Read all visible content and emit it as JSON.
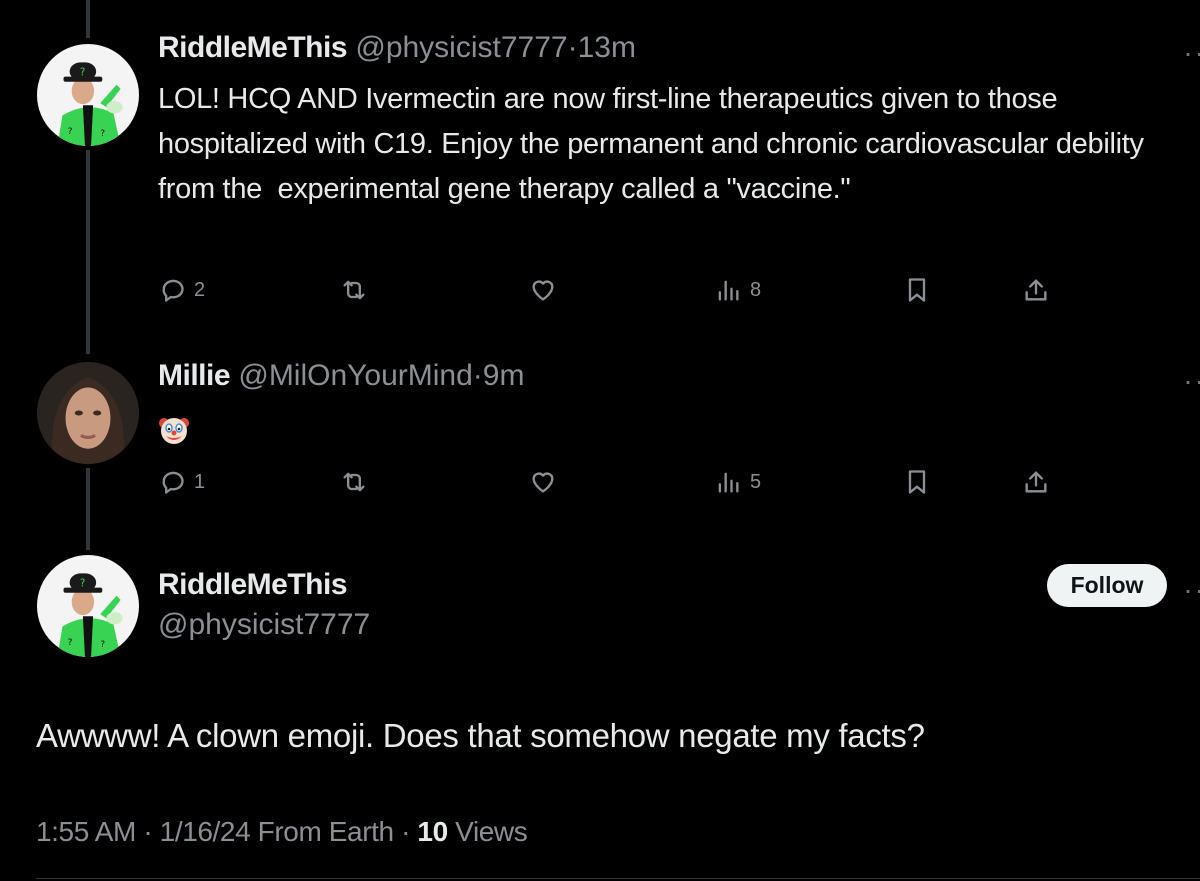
{
  "thread": [
    {
      "display_name": "RiddleMeThis",
      "handle": "@physicist7777",
      "separator": "·",
      "time": "13m",
      "text": "LOL! HCQ AND Ivermectin are now first-line therapeutics given to those hospitalized with C19. Enjoy the permanent and chronic cardiovascular debility from the  experimental gene therapy called a \"vaccine.\"",
      "more_label": "··",
      "stats": {
        "replies": "2",
        "reposts": "",
        "likes": "",
        "views": "8"
      },
      "avatar": {
        "description": "Riddler in bowler hat and green question-mark suit",
        "accent": "#3ddc56"
      }
    },
    {
      "display_name": "Millie",
      "handle": "@MilOnYourMind",
      "separator": "·",
      "time": "9m",
      "text": "🤡",
      "emoji": "clown-face",
      "more_label": "··",
      "stats": {
        "replies": "1",
        "reposts": "",
        "likes": "",
        "views": "5"
      },
      "avatar": {
        "description": "Woman with dark hair",
        "accent": "#6b4a3a"
      }
    }
  ],
  "main_tweet": {
    "display_name": "RiddleMeThis",
    "handle": "@physicist7777",
    "follow_label": "Follow",
    "more_label": "··",
    "text": "Awwww! A clown emoji. Does that somehow negate my facts?",
    "time": "1:55 AM",
    "date": "1/16/24",
    "source": "From Earth",
    "separator": "·",
    "views_count": "10",
    "views_label": "Views"
  },
  "colors": {
    "background": "#000000",
    "text": "#e7e9ea",
    "muted": "#8b8f94",
    "follow_bg": "#eff3f4",
    "thread_line": "#333639"
  }
}
